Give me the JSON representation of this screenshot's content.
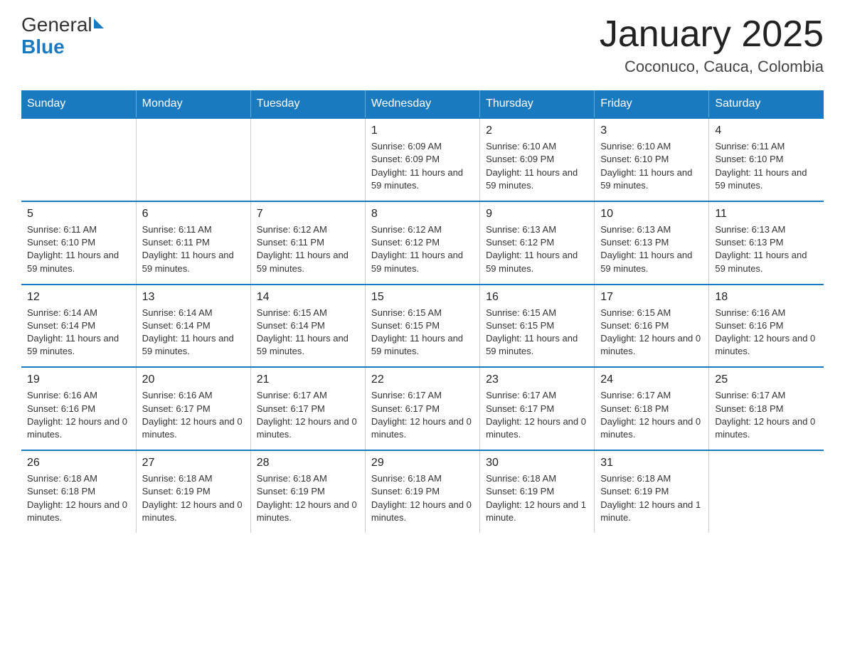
{
  "header": {
    "logo": {
      "text_general": "General",
      "text_blue": "Blue"
    },
    "title": "January 2025",
    "subtitle": "Coconuco, Cauca, Colombia"
  },
  "calendar": {
    "weekdays": [
      "Sunday",
      "Monday",
      "Tuesday",
      "Wednesday",
      "Thursday",
      "Friday",
      "Saturday"
    ],
    "weeks": [
      [
        {
          "day": "",
          "info": ""
        },
        {
          "day": "",
          "info": ""
        },
        {
          "day": "",
          "info": ""
        },
        {
          "day": "1",
          "info": "Sunrise: 6:09 AM\nSunset: 6:09 PM\nDaylight: 11 hours and 59 minutes."
        },
        {
          "day": "2",
          "info": "Sunrise: 6:10 AM\nSunset: 6:09 PM\nDaylight: 11 hours and 59 minutes."
        },
        {
          "day": "3",
          "info": "Sunrise: 6:10 AM\nSunset: 6:10 PM\nDaylight: 11 hours and 59 minutes."
        },
        {
          "day": "4",
          "info": "Sunrise: 6:11 AM\nSunset: 6:10 PM\nDaylight: 11 hours and 59 minutes."
        }
      ],
      [
        {
          "day": "5",
          "info": "Sunrise: 6:11 AM\nSunset: 6:10 PM\nDaylight: 11 hours and 59 minutes."
        },
        {
          "day": "6",
          "info": "Sunrise: 6:11 AM\nSunset: 6:11 PM\nDaylight: 11 hours and 59 minutes."
        },
        {
          "day": "7",
          "info": "Sunrise: 6:12 AM\nSunset: 6:11 PM\nDaylight: 11 hours and 59 minutes."
        },
        {
          "day": "8",
          "info": "Sunrise: 6:12 AM\nSunset: 6:12 PM\nDaylight: 11 hours and 59 minutes."
        },
        {
          "day": "9",
          "info": "Sunrise: 6:13 AM\nSunset: 6:12 PM\nDaylight: 11 hours and 59 minutes."
        },
        {
          "day": "10",
          "info": "Sunrise: 6:13 AM\nSunset: 6:13 PM\nDaylight: 11 hours and 59 minutes."
        },
        {
          "day": "11",
          "info": "Sunrise: 6:13 AM\nSunset: 6:13 PM\nDaylight: 11 hours and 59 minutes."
        }
      ],
      [
        {
          "day": "12",
          "info": "Sunrise: 6:14 AM\nSunset: 6:14 PM\nDaylight: 11 hours and 59 minutes."
        },
        {
          "day": "13",
          "info": "Sunrise: 6:14 AM\nSunset: 6:14 PM\nDaylight: 11 hours and 59 minutes."
        },
        {
          "day": "14",
          "info": "Sunrise: 6:15 AM\nSunset: 6:14 PM\nDaylight: 11 hours and 59 minutes."
        },
        {
          "day": "15",
          "info": "Sunrise: 6:15 AM\nSunset: 6:15 PM\nDaylight: 11 hours and 59 minutes."
        },
        {
          "day": "16",
          "info": "Sunrise: 6:15 AM\nSunset: 6:15 PM\nDaylight: 11 hours and 59 minutes."
        },
        {
          "day": "17",
          "info": "Sunrise: 6:15 AM\nSunset: 6:16 PM\nDaylight: 12 hours and 0 minutes."
        },
        {
          "day": "18",
          "info": "Sunrise: 6:16 AM\nSunset: 6:16 PM\nDaylight: 12 hours and 0 minutes."
        }
      ],
      [
        {
          "day": "19",
          "info": "Sunrise: 6:16 AM\nSunset: 6:16 PM\nDaylight: 12 hours and 0 minutes."
        },
        {
          "day": "20",
          "info": "Sunrise: 6:16 AM\nSunset: 6:17 PM\nDaylight: 12 hours and 0 minutes."
        },
        {
          "day": "21",
          "info": "Sunrise: 6:17 AM\nSunset: 6:17 PM\nDaylight: 12 hours and 0 minutes."
        },
        {
          "day": "22",
          "info": "Sunrise: 6:17 AM\nSunset: 6:17 PM\nDaylight: 12 hours and 0 minutes."
        },
        {
          "day": "23",
          "info": "Sunrise: 6:17 AM\nSunset: 6:17 PM\nDaylight: 12 hours and 0 minutes."
        },
        {
          "day": "24",
          "info": "Sunrise: 6:17 AM\nSunset: 6:18 PM\nDaylight: 12 hours and 0 minutes."
        },
        {
          "day": "25",
          "info": "Sunrise: 6:17 AM\nSunset: 6:18 PM\nDaylight: 12 hours and 0 minutes."
        }
      ],
      [
        {
          "day": "26",
          "info": "Sunrise: 6:18 AM\nSunset: 6:18 PM\nDaylight: 12 hours and 0 minutes."
        },
        {
          "day": "27",
          "info": "Sunrise: 6:18 AM\nSunset: 6:19 PM\nDaylight: 12 hours and 0 minutes."
        },
        {
          "day": "28",
          "info": "Sunrise: 6:18 AM\nSunset: 6:19 PM\nDaylight: 12 hours and 0 minutes."
        },
        {
          "day": "29",
          "info": "Sunrise: 6:18 AM\nSunset: 6:19 PM\nDaylight: 12 hours and 0 minutes."
        },
        {
          "day": "30",
          "info": "Sunrise: 6:18 AM\nSunset: 6:19 PM\nDaylight: 12 hours and 1 minute."
        },
        {
          "day": "31",
          "info": "Sunrise: 6:18 AM\nSunset: 6:19 PM\nDaylight: 12 hours and 1 minute."
        },
        {
          "day": "",
          "info": ""
        }
      ]
    ]
  }
}
